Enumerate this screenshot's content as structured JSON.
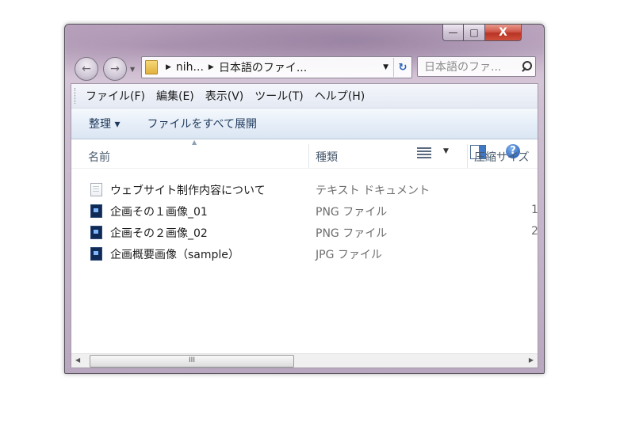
{
  "window": {
    "controls": {
      "minimize": "—",
      "maximize": "□",
      "close": "X"
    }
  },
  "nav": {
    "back": "←",
    "forward": "→",
    "address": {
      "crumb_1": "nih...",
      "crumb_2": "日本語のファイ...",
      "dropdown": "▼",
      "refresh": "↻"
    },
    "search": {
      "placeholder": "日本語のファ..."
    }
  },
  "menubar": {
    "items": [
      "ファイル(F)",
      "編集(E)",
      "表示(V)",
      "ツール(T)",
      "ヘルプ(H)"
    ]
  },
  "commandbar": {
    "organize": "整理 ▾",
    "extract_all": "ファイルをすべて展開",
    "view_dropdown": "▼",
    "help": "?"
  },
  "columns": {
    "name": "名前",
    "type": "種類",
    "compressed_size": "圧縮サイズ"
  },
  "files": [
    {
      "name": "ウェブサイト制作内容について",
      "type": "テキスト ドキュメント",
      "icon": "text-document-icon",
      "size": ""
    },
    {
      "name": "企画その１画像_01",
      "type": "PNG ファイル",
      "icon": "image-file-icon",
      "size": "1"
    },
    {
      "name": "企画その２画像_02",
      "type": "PNG ファイル",
      "icon": "image-file-icon",
      "size": "2"
    },
    {
      "name": "企画概要画像（sample）",
      "type": "JPG ファイル",
      "icon": "image-file-icon",
      "size": ""
    }
  ],
  "scrollbar": {
    "left": "◀",
    "right": "▶",
    "grip": "III"
  }
}
